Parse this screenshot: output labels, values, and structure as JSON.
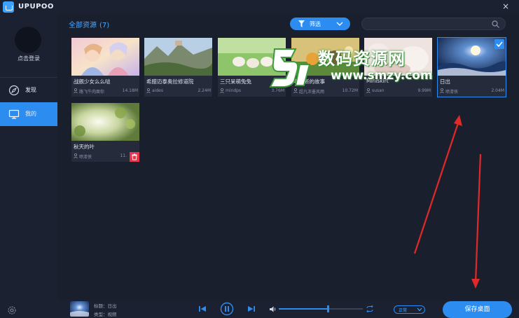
{
  "app": {
    "title": "UPUPOO",
    "close_glyph": "×"
  },
  "sidebar": {
    "login_label": "点击登录",
    "items": [
      {
        "label": "发现",
        "icon": "compass-icon",
        "active": false
      },
      {
        "label": "我的",
        "icon": "monitor-icon",
        "active": true
      }
    ],
    "settings_icon": "gear-icon"
  },
  "main": {
    "section_title": "全部资源",
    "section_count": "(7)",
    "filter_label": "筛选",
    "search": {
      "value": "",
      "placeholder": ""
    },
    "cards": [
      {
        "title": "战舰少女么么哒",
        "author": "路飞牛肉面你",
        "size": "14.18M",
        "selected": false,
        "deletable": false
      },
      {
        "title": "希腊迈泰奥拉修道院",
        "author": "aides",
        "size": "2.24M",
        "selected": false,
        "deletable": false
      },
      {
        "title": "三只呆萌兔兔",
        "author": "mindps",
        "size": "3.76M",
        "selected": false,
        "deletable": false
      },
      {
        "title": "老鹰断的故事",
        "author": "超凡浓墨风雨",
        "size": "10.72M",
        "selected": false,
        "deletable": false
      },
      {
        "title": "Miniskirt",
        "author": "susan",
        "size": "9.99M",
        "selected": false,
        "deletable": false
      },
      {
        "title": "日出",
        "author": "喷漆侠",
        "size": "2.04M",
        "selected": true,
        "deletable": false
      },
      {
        "title": "秋天的叶",
        "author": "喷漆侠",
        "size": "11.",
        "selected": false,
        "deletable": true
      }
    ]
  },
  "watermark": {
    "text": "数码资源网",
    "url": "www.smzy.com"
  },
  "player": {
    "now_title": "标题：日出",
    "now_type": "类型：视频",
    "volume": 0.58,
    "speed_label": "正常",
    "save_label": "保存桌面"
  },
  "colors": {
    "accent": "#2d8cf0",
    "delete": "#e8334a",
    "annotation": "#e02a2a"
  }
}
